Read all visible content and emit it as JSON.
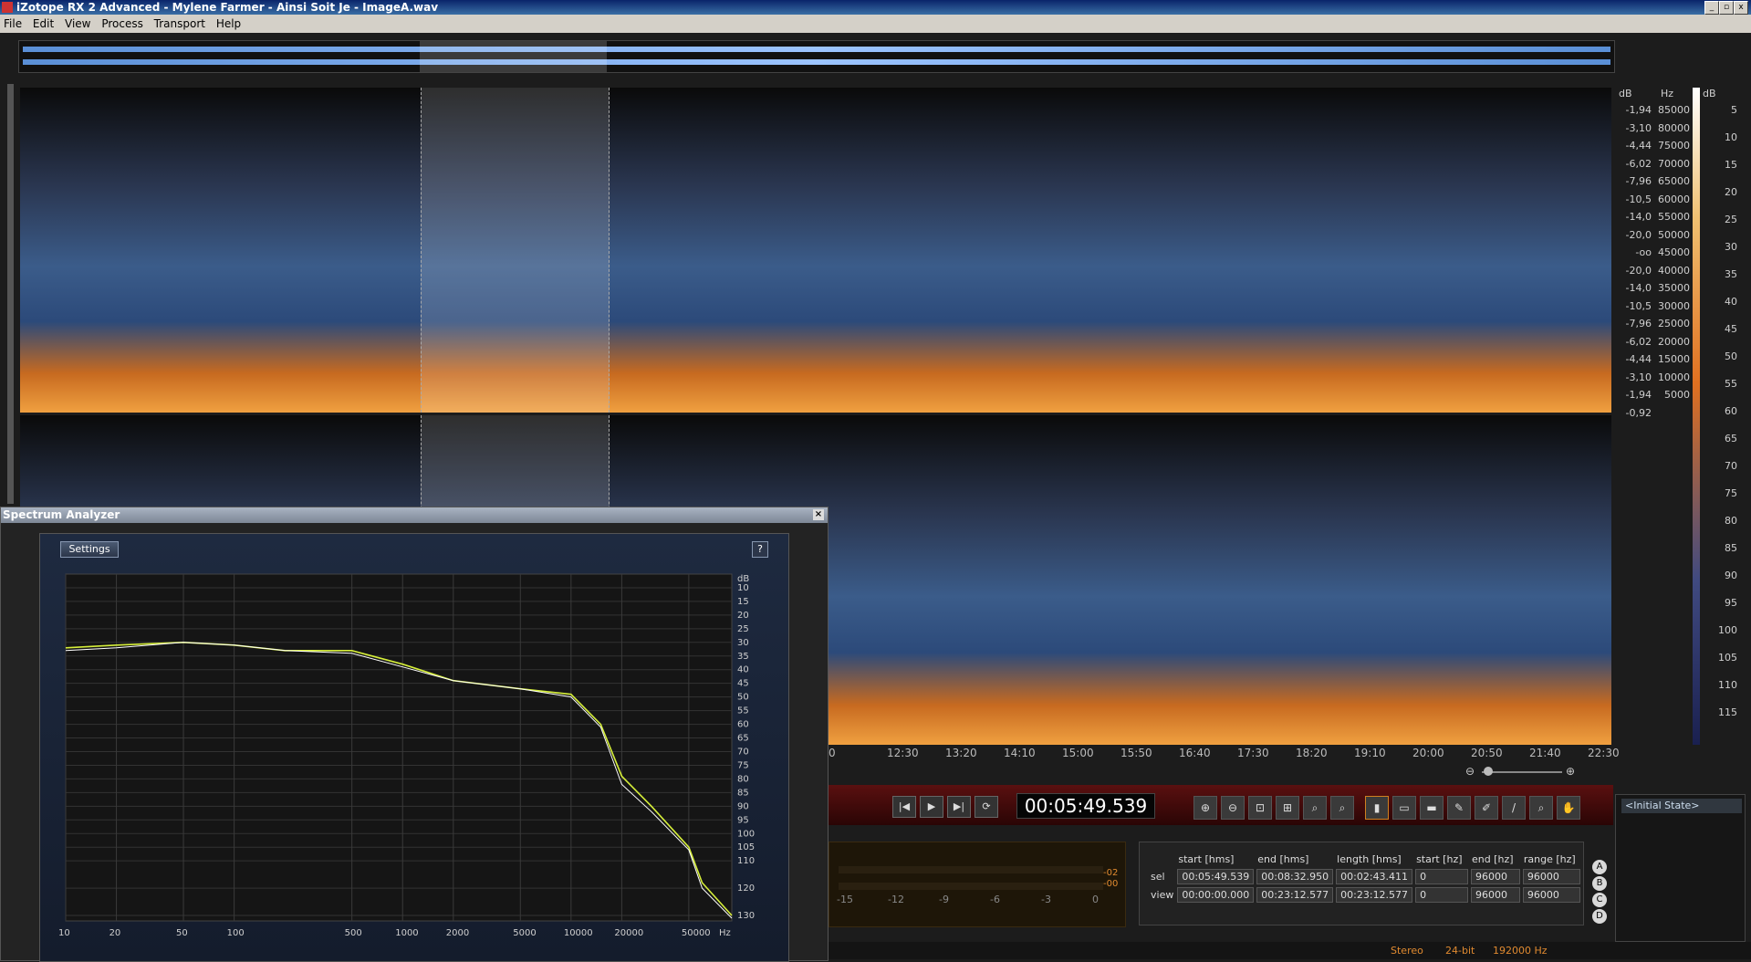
{
  "window": {
    "title": "iZotope RX 2 Advanced - Mylene Farmer - Ainsi Soit Je - ImageA.wav",
    "min": "_",
    "max": "▫",
    "close": "x"
  },
  "menu": [
    "File",
    "Edit",
    "View",
    "Process",
    "Transport",
    "Help"
  ],
  "db_scale": {
    "unit": "dB",
    "values": [
      "-1,94",
      "-3,10",
      "-4,44",
      "-6,02",
      "-7,96",
      "-10,5",
      "-14,0",
      "-20,0",
      "-oo",
      "-20,0",
      "-14,0",
      "-10,5",
      "-7,96",
      "-6,02",
      "-4,44",
      "-3,10",
      "-1,94",
      "-0,92"
    ]
  },
  "hz_scale": {
    "unit": "Hz",
    "values": [
      "85000",
      "80000",
      "75000",
      "70000",
      "65000",
      "60000",
      "55000",
      "50000",
      "45000",
      "40000",
      "35000",
      "30000",
      "25000",
      "20000",
      "15000",
      "10000",
      "5000"
    ]
  },
  "db_color_scale": {
    "unit": "dB",
    "values": [
      "5",
      "10",
      "15",
      "20",
      "25",
      "30",
      "35",
      "40",
      "45",
      "50",
      "55",
      "60",
      "65",
      "70",
      "75",
      "80",
      "85",
      "90",
      "95",
      "100",
      "105",
      "110",
      "115"
    ]
  },
  "time_axis": [
    "0",
    "12:30",
    "13:20",
    "14:10",
    "15:00",
    "15:50",
    "16:40",
    "17:30",
    "18:20",
    "19:10",
    "20:00",
    "20:50",
    "21:40",
    "22:30"
  ],
  "transport": {
    "timecode": "00:05:49.539",
    "buttons": [
      "|◀",
      "▶",
      "▶|",
      "⟳"
    ]
  },
  "meter": {
    "ticks": [
      "-15",
      "-12",
      "-9",
      "-6",
      "-3",
      "0"
    ],
    "peak_top": "-02",
    "peak_bottom": "-00"
  },
  "selection_info": {
    "headers": [
      "start [hms]",
      "end [hms]",
      "length [hms]",
      "start [hz]",
      "end [hz]",
      "range [hz]"
    ],
    "rows": [
      {
        "label": "sel",
        "values": [
          "00:05:49.539",
          "00:08:32.950",
          "00:02:43.411",
          "0",
          "96000",
          "96000"
        ]
      },
      {
        "label": "view",
        "values": [
          "00:00:00.000",
          "00:23:12.577",
          "00:23:12.577",
          "0",
          "96000",
          "96000"
        ]
      }
    ]
  },
  "history": {
    "item": "<Initial State>"
  },
  "snapshots": [
    "A",
    "B",
    "C",
    "D"
  ],
  "status": {
    "channels": "Stereo",
    "bits": "24-bit",
    "rate": "192000 Hz"
  },
  "spectrum_analyzer": {
    "title": "Spectrum Analyzer",
    "settings_label": "Settings",
    "help_label": "?",
    "db_unit": "dB",
    "hz_unit": "Hz",
    "db_ticks": [
      "10",
      "15",
      "20",
      "25",
      "30",
      "35",
      "40",
      "45",
      "50",
      "55",
      "60",
      "65",
      "70",
      "75",
      "80",
      "85",
      "90",
      "95",
      "100",
      "105",
      "110",
      "120",
      "130"
    ],
    "hz_ticks": [
      "10",
      "20",
      "50",
      "100",
      "500",
      "1000",
      "2000",
      "5000",
      "10000",
      "20000",
      "50000"
    ],
    "colors": {
      "series_a": "#d6ef3a",
      "series_b": "#ffffff"
    }
  },
  "chart_data": {
    "type": "line",
    "xlabel": "Hz",
    "ylabel": "dB",
    "xscale": "log",
    "xlim": [
      10,
      90000
    ],
    "ylim": [
      5,
      132
    ],
    "x": [
      10,
      20,
      50,
      100,
      200,
      500,
      1000,
      2000,
      5000,
      10000,
      15000,
      20000,
      30000,
      50000,
      60000,
      90000
    ],
    "series": [
      {
        "values": [
          32,
          31,
          30,
          31,
          33,
          33,
          38,
          44,
          47,
          49,
          60,
          79,
          90,
          105,
          118,
          130
        ]
      },
      {
        "values": [
          33,
          32,
          30,
          31,
          33,
          34,
          39,
          44,
          47,
          50,
          61,
          82,
          92,
          106,
          120,
          131
        ]
      }
    ]
  }
}
